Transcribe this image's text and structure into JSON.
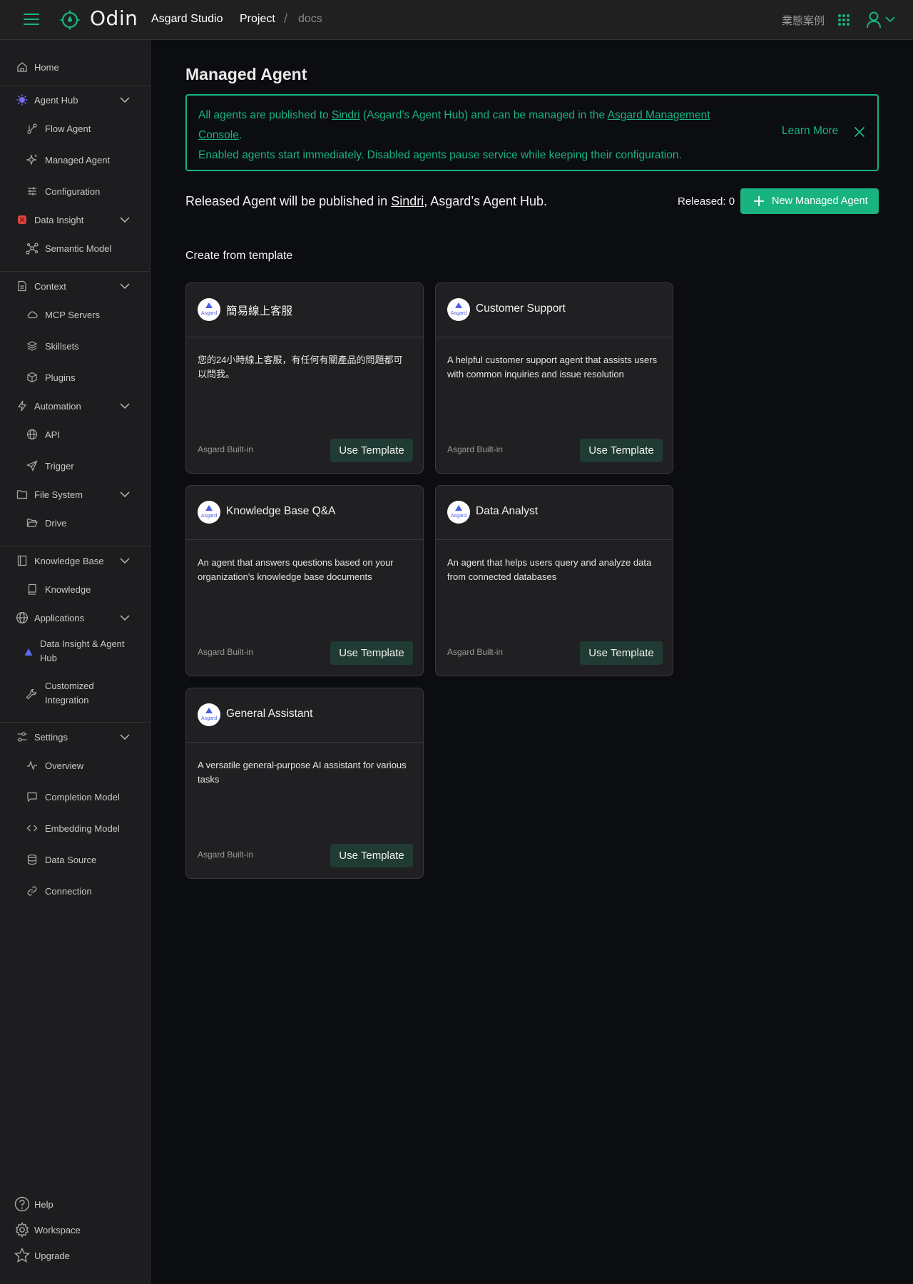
{
  "header": {
    "logo_text": "Odin",
    "studio": "Asgard Studio",
    "breadcrumb": [
      "Project",
      "/",
      "docs"
    ],
    "top_link": "業態案例"
  },
  "sidebar": {
    "home": "Home",
    "agent_hub": "Agent Hub",
    "flow_agent": "Flow Agent",
    "managed_agent": "Managed Agent",
    "configuration": "Configuration",
    "data_insight": "Data Insight",
    "semantic_model": "Semantic Model",
    "context": "Context",
    "mcp_servers": "MCP Servers",
    "skillsets": "Skillsets",
    "plugins": "Plugins",
    "automation": "Automation",
    "api": "API",
    "trigger": "Trigger",
    "file_system": "File System",
    "drive": "Drive",
    "knowledge_base": "Knowledge Base",
    "knowledge": "Knowledge",
    "applications": "Applications",
    "data_insight_agent_hub_1": "Data Insight & Agent",
    "data_insight_agent_hub_2": "Hub",
    "customized_integration_1": "Customized",
    "customized_integration_2": "Integration",
    "settings": "Settings",
    "overview": "Overview",
    "completion_model": "Completion Model",
    "embedding_model": "Embedding Model",
    "data_source": "Data Source",
    "connection": "Connection",
    "help": "Help",
    "workspace": "Workspace",
    "upgrade": "Upgrade"
  },
  "main": {
    "title": "Managed Agent",
    "notice": {
      "l1_a": "All agents are published to ",
      "l1_link1": "Sindri",
      "l1_b": " (Asgard’s Agent Hub) and can be managed in the ",
      "l1_link2a": "Asgard Management ",
      "l2_link2b": "Console",
      "l2_c": ".",
      "l3": "Enabled agents start immediately. Disabled agents pause service while keeping their configuration.",
      "learn_more": "Learn More"
    },
    "released_line_a": "Released Agent will be published in ",
    "released_line_link": "Sindri",
    "released_line_b": ", Asgard’s Agent Hub.",
    "released_count": "Released: 0",
    "new_button": "New Managed Agent",
    "section_title": "Create from template",
    "templates": [
      {
        "title": "簡易線上客服",
        "desc": "您的24小時線上客服，有任何有關產品的問題都可以問我。",
        "source": "Asgard Built-in",
        "button": "Use Template",
        "logo_text": "Asgard"
      },
      {
        "title": "Customer Support",
        "desc": "A helpful customer support agent that assists users with common inquiries and issue resolution",
        "source": "Asgard Built-in",
        "button": "Use Template",
        "logo_text": "Asgard"
      },
      {
        "title": "Knowledge Base Q&A",
        "desc": "An agent that answers questions based on your organization's knowledge base documents",
        "source": "Asgard Built-in",
        "button": "Use Template",
        "logo_text": "Asgard"
      },
      {
        "title": "Data Analyst",
        "desc": "An agent that helps users query and analyze data from connected databases",
        "source": "Asgard Built-in",
        "button": "Use Template",
        "logo_text": "Asgard"
      },
      {
        "title": "General Assistant",
        "desc": "A versatile general-purpose AI assistant for various tasks",
        "source": "Asgard Built-in",
        "button": "Use Template",
        "logo_text": "Asgard"
      }
    ]
  },
  "colors": {
    "accent": "#19b37f",
    "background": "#0c0d11",
    "sidebar": "#1d1d1f",
    "card": "#202022",
    "button_dark": "#1f3b33"
  }
}
